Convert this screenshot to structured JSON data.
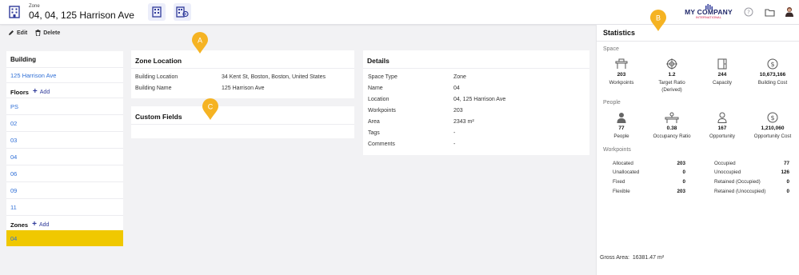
{
  "header": {
    "subtitle": "Zone",
    "title": "04, 04, 125 Harrison Ave",
    "logo_name": "MY COMPANY",
    "logo_tag": "INTERNATIONAL"
  },
  "toolbar": {
    "edit_label": "Edit",
    "delete_label": "Delete"
  },
  "nav": {
    "building_heading": "Building",
    "building_name": "125 Harrison Ave",
    "floors_label": "Floors",
    "add_label": "Add",
    "floors": [
      "PS",
      "02",
      "03",
      "04",
      "06",
      "09",
      "11"
    ],
    "zones_label": "Zones",
    "zones": [
      "04"
    ]
  },
  "zone_location": {
    "title": "Zone Location",
    "rows": [
      {
        "label": "Building Location",
        "value": "34 Kent St, Boston, Boston, United States"
      },
      {
        "label": "Building Name",
        "value": "125 Harrison Ave"
      }
    ]
  },
  "custom_fields": {
    "title": "Custom Fields"
  },
  "details": {
    "title": "Details",
    "rows": [
      {
        "label": "Space Type",
        "value": "Zone"
      },
      {
        "label": "Name",
        "value": "04"
      },
      {
        "label": "Location",
        "value": "04, 125 Harrison Ave"
      },
      {
        "label": "Workpoints",
        "value": "203"
      },
      {
        "label": "Area",
        "value": "2343 m²"
      },
      {
        "label": "Tags",
        "value": "-"
      },
      {
        "label": "Comments",
        "value": "-"
      }
    ]
  },
  "statistics": {
    "title": "Statistics",
    "space_label": "Space",
    "space": [
      {
        "icon": "workpoints-icon",
        "value": "203",
        "label": "Workpoints"
      },
      {
        "icon": "target-icon",
        "value": "1.2",
        "label": "Target Ratio",
        "label2": "(Derived)"
      },
      {
        "icon": "capacity-icon",
        "value": "244",
        "label": "Capacity"
      },
      {
        "icon": "dollar-icon",
        "value": "10,673,166",
        "label": "Building Cost"
      }
    ],
    "people_label": "People",
    "people": [
      {
        "icon": "person-icon",
        "value": "77",
        "label": "People"
      },
      {
        "icon": "occupancy-icon",
        "value": "0.38",
        "label": "Occupancy Ratio"
      },
      {
        "icon": "person-outline-icon",
        "value": "167",
        "label": "Opportunity"
      },
      {
        "icon": "dollar-icon",
        "value": "1,210,060",
        "label": "Opportunity Cost"
      }
    ],
    "workpoints_label": "Workpoints",
    "workpoints_left": [
      {
        "label": "Allocated",
        "value": "203"
      },
      {
        "label": "Unallocated",
        "value": "0"
      },
      {
        "label": "Fixed",
        "value": "0"
      },
      {
        "label": "Flexible",
        "value": "203"
      }
    ],
    "workpoints_right": [
      {
        "label": "Occupied",
        "value": "77"
      },
      {
        "label": "Unoccupied",
        "value": "126"
      },
      {
        "label": "Retained (Occupied)",
        "value": "0"
      },
      {
        "label": "Retained (Unoccupied)",
        "value": "0"
      }
    ],
    "gross_area_label": "Gross Area:",
    "gross_area_value": "16381.47 m²"
  },
  "markers": {
    "a": "A",
    "b": "B",
    "c": "C"
  },
  "colors": {
    "accent": "#2f3a9a",
    "link": "#2f6fd6",
    "active_zone": "#f0c800",
    "marker": "#f5b323"
  }
}
